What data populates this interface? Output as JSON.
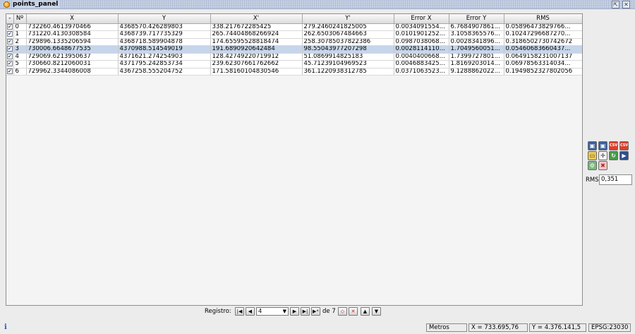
{
  "window": {
    "title": "points_panel"
  },
  "table": {
    "columns": [
      "-",
      "Nº",
      "X",
      "Y",
      "X'",
      "Y'",
      "Error X",
      "Error Y",
      "RMS"
    ],
    "rows": [
      {
        "checked": true,
        "n": "0",
        "x": "732260.4613970466",
        "y": "4368570.426289803",
        "xp": "338.217672285425",
        "yp": "279.2460241825005",
        "ex": "0.0034091554...",
        "ey": "6.7684907861...",
        "rms": "0.05896473829766..."
      },
      {
        "checked": true,
        "n": "1",
        "x": "731220.4130308584",
        "y": "4368739.717735329",
        "xp": "265.74404868266924",
        "yp": "262.6503067484663",
        "ex": "0.0101901252...",
        "ey": "3.1058365576...",
        "rms": "0.10247296687270..."
      },
      {
        "checked": true,
        "n": "2",
        "x": "729896.1335206594",
        "y": "4368718.589904878",
        "xp": "174.65595528818474",
        "yp": "258.30785037822386",
        "ex": "0.0987038068...",
        "ey": "0.0028341896...",
        "rms": "0.3186502730742672"
      },
      {
        "checked": true,
        "n": "3",
        "x": "730006.6648677535",
        "y": "4370988.514549019",
        "xp": "191.6890920642484",
        "yp": "98.55043977207298",
        "ex": "0.0028114110...",
        "ey": "1.7049560051...",
        "rms": "0.05460683660437..."
      },
      {
        "checked": true,
        "n": "4",
        "x": "729069.6213950637",
        "y": "4371621.274254903",
        "xp": "128.42749220719912",
        "yp": "51.0869914825183",
        "ex": "0.0040400668...",
        "ey": "1.7399727801...",
        "rms": "0.0649158231007137"
      },
      {
        "checked": true,
        "n": "5",
        "x": "730660.8212060031",
        "y": "4371795.242853734",
        "xp": "239.62307661762662",
        "yp": "45.71239104969523",
        "ex": "0.0046883425...",
        "ey": "1.8169203014...",
        "rms": "0.06978563314034..."
      },
      {
        "checked": true,
        "n": "6",
        "x": "729962.3344086008",
        "y": "4367258.555204752",
        "xp": "171.58160104830546",
        "yp": "361.1220938312785",
        "ex": "0.0371063523...",
        "ey": "9.1288862022...",
        "rms": "0.1949852327802056"
      }
    ]
  },
  "tools": {
    "icons": [
      "save-icon",
      "save-as-icon",
      "export-csv-icon",
      "import-csv-icon",
      "folder-open-icon",
      "center-point-icon",
      "refresh-icon",
      "transform-icon",
      "settings-icon",
      "delete-all-icon"
    ],
    "csv_label": "CSV",
    "rms_label": "RMS:",
    "rms_value": "0,351"
  },
  "navigation": {
    "label": "Registro:",
    "current": "4",
    "of_text": "de 7"
  },
  "status": {
    "units": "Metros",
    "x_coord": "X = 733.695,76",
    "y_coord": "Y = 4.376.141,5",
    "epsg": "EPSG:23030"
  }
}
